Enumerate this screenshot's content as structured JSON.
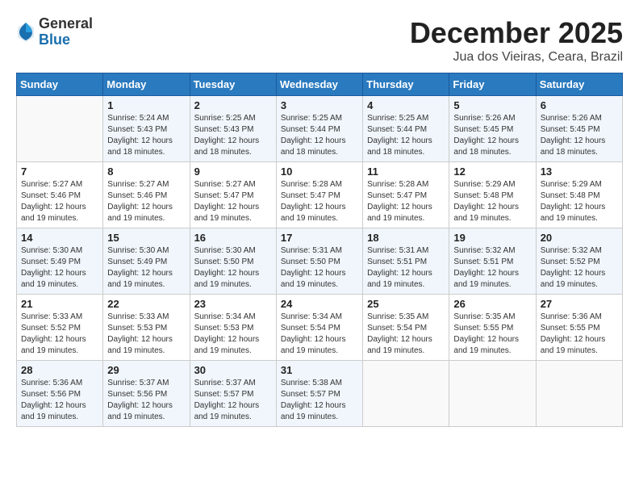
{
  "header": {
    "logo_general": "General",
    "logo_blue": "Blue",
    "month_title": "December 2025",
    "location": "Jua dos Vieiras, Ceara, Brazil"
  },
  "days_of_week": [
    "Sunday",
    "Monday",
    "Tuesday",
    "Wednesday",
    "Thursday",
    "Friday",
    "Saturday"
  ],
  "weeks": [
    [
      {
        "day": "",
        "info": ""
      },
      {
        "day": "1",
        "info": "Sunrise: 5:24 AM\nSunset: 5:43 PM\nDaylight: 12 hours\nand 18 minutes."
      },
      {
        "day": "2",
        "info": "Sunrise: 5:25 AM\nSunset: 5:43 PM\nDaylight: 12 hours\nand 18 minutes."
      },
      {
        "day": "3",
        "info": "Sunrise: 5:25 AM\nSunset: 5:44 PM\nDaylight: 12 hours\nand 18 minutes."
      },
      {
        "day": "4",
        "info": "Sunrise: 5:25 AM\nSunset: 5:44 PM\nDaylight: 12 hours\nand 18 minutes."
      },
      {
        "day": "5",
        "info": "Sunrise: 5:26 AM\nSunset: 5:45 PM\nDaylight: 12 hours\nand 18 minutes."
      },
      {
        "day": "6",
        "info": "Sunrise: 5:26 AM\nSunset: 5:45 PM\nDaylight: 12 hours\nand 18 minutes."
      }
    ],
    [
      {
        "day": "7",
        "info": "Sunrise: 5:27 AM\nSunset: 5:46 PM\nDaylight: 12 hours\nand 19 minutes."
      },
      {
        "day": "8",
        "info": "Sunrise: 5:27 AM\nSunset: 5:46 PM\nDaylight: 12 hours\nand 19 minutes."
      },
      {
        "day": "9",
        "info": "Sunrise: 5:27 AM\nSunset: 5:47 PM\nDaylight: 12 hours\nand 19 minutes."
      },
      {
        "day": "10",
        "info": "Sunrise: 5:28 AM\nSunset: 5:47 PM\nDaylight: 12 hours\nand 19 minutes."
      },
      {
        "day": "11",
        "info": "Sunrise: 5:28 AM\nSunset: 5:47 PM\nDaylight: 12 hours\nand 19 minutes."
      },
      {
        "day": "12",
        "info": "Sunrise: 5:29 AM\nSunset: 5:48 PM\nDaylight: 12 hours\nand 19 minutes."
      },
      {
        "day": "13",
        "info": "Sunrise: 5:29 AM\nSunset: 5:48 PM\nDaylight: 12 hours\nand 19 minutes."
      }
    ],
    [
      {
        "day": "14",
        "info": "Sunrise: 5:30 AM\nSunset: 5:49 PM\nDaylight: 12 hours\nand 19 minutes."
      },
      {
        "day": "15",
        "info": "Sunrise: 5:30 AM\nSunset: 5:49 PM\nDaylight: 12 hours\nand 19 minutes."
      },
      {
        "day": "16",
        "info": "Sunrise: 5:30 AM\nSunset: 5:50 PM\nDaylight: 12 hours\nand 19 minutes."
      },
      {
        "day": "17",
        "info": "Sunrise: 5:31 AM\nSunset: 5:50 PM\nDaylight: 12 hours\nand 19 minutes."
      },
      {
        "day": "18",
        "info": "Sunrise: 5:31 AM\nSunset: 5:51 PM\nDaylight: 12 hours\nand 19 minutes."
      },
      {
        "day": "19",
        "info": "Sunrise: 5:32 AM\nSunset: 5:51 PM\nDaylight: 12 hours\nand 19 minutes."
      },
      {
        "day": "20",
        "info": "Sunrise: 5:32 AM\nSunset: 5:52 PM\nDaylight: 12 hours\nand 19 minutes."
      }
    ],
    [
      {
        "day": "21",
        "info": "Sunrise: 5:33 AM\nSunset: 5:52 PM\nDaylight: 12 hours\nand 19 minutes."
      },
      {
        "day": "22",
        "info": "Sunrise: 5:33 AM\nSunset: 5:53 PM\nDaylight: 12 hours\nand 19 minutes."
      },
      {
        "day": "23",
        "info": "Sunrise: 5:34 AM\nSunset: 5:53 PM\nDaylight: 12 hours\nand 19 minutes."
      },
      {
        "day": "24",
        "info": "Sunrise: 5:34 AM\nSunset: 5:54 PM\nDaylight: 12 hours\nand 19 minutes."
      },
      {
        "day": "25",
        "info": "Sunrise: 5:35 AM\nSunset: 5:54 PM\nDaylight: 12 hours\nand 19 minutes."
      },
      {
        "day": "26",
        "info": "Sunrise: 5:35 AM\nSunset: 5:55 PM\nDaylight: 12 hours\nand 19 minutes."
      },
      {
        "day": "27",
        "info": "Sunrise: 5:36 AM\nSunset: 5:55 PM\nDaylight: 12 hours\nand 19 minutes."
      }
    ],
    [
      {
        "day": "28",
        "info": "Sunrise: 5:36 AM\nSunset: 5:56 PM\nDaylight: 12 hours\nand 19 minutes."
      },
      {
        "day": "29",
        "info": "Sunrise: 5:37 AM\nSunset: 5:56 PM\nDaylight: 12 hours\nand 19 minutes."
      },
      {
        "day": "30",
        "info": "Sunrise: 5:37 AM\nSunset: 5:57 PM\nDaylight: 12 hours\nand 19 minutes."
      },
      {
        "day": "31",
        "info": "Sunrise: 5:38 AM\nSunset: 5:57 PM\nDaylight: 12 hours\nand 19 minutes."
      },
      {
        "day": "",
        "info": ""
      },
      {
        "day": "",
        "info": ""
      },
      {
        "day": "",
        "info": ""
      }
    ]
  ]
}
